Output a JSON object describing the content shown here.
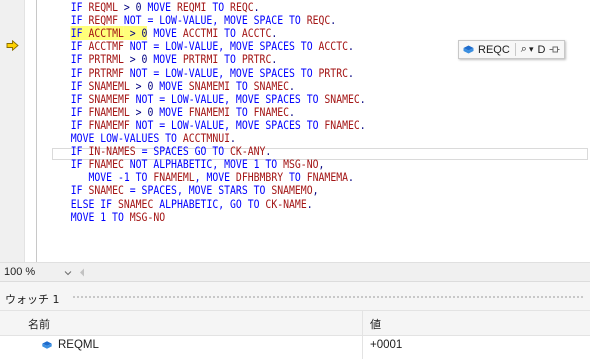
{
  "editor": {
    "lines": [
      [
        {
          "t": "            "
        },
        {
          "t": "IF ",
          "c": "kw"
        },
        {
          "t": "REQML",
          "c": "id"
        },
        {
          "t": " > 0 ",
          "c": "pl"
        },
        {
          "t": "MOVE ",
          "c": "kw"
        },
        {
          "t": "REQMI",
          "c": "id"
        },
        {
          "t": " TO ",
          "c": "kw"
        },
        {
          "t": "REQC",
          "c": "id"
        },
        {
          "t": ".",
          "c": "pl"
        }
      ],
      [
        {
          "t": "            "
        },
        {
          "t": "IF ",
          "c": "kw"
        },
        {
          "t": "REQMF",
          "c": "id"
        },
        {
          "t": " NOT = LOW-VALUE, MOVE SPACE TO ",
          "c": "kw"
        },
        {
          "t": "REQC",
          "c": "id"
        },
        {
          "t": ".",
          "c": "pl"
        }
      ],
      [
        {
          "t": "            "
        },
        {
          "t": "IF ",
          "c": "kw",
          "h": 1
        },
        {
          "t": "ACCTML",
          "c": "id",
          "h": 1
        },
        {
          "t": " > 0",
          "c": "pl",
          "h": 1
        },
        {
          "t": " MOVE ",
          "c": "kw"
        },
        {
          "t": "ACCTMI",
          "c": "id"
        },
        {
          "t": " TO ",
          "c": "kw"
        },
        {
          "t": "ACCTC",
          "c": "id"
        },
        {
          "t": ".",
          "c": "pl"
        }
      ],
      [
        {
          "t": "            "
        },
        {
          "t": "IF ",
          "c": "kw"
        },
        {
          "t": "ACCTMF",
          "c": "id"
        },
        {
          "t": " NOT = LOW-VALUE, MOVE SPACES TO ",
          "c": "kw"
        },
        {
          "t": "ACCTC",
          "c": "id"
        },
        {
          "t": ".",
          "c": "pl"
        }
      ],
      [
        {
          "t": "            "
        },
        {
          "t": "IF ",
          "c": "kw"
        },
        {
          "t": "PRTRML",
          "c": "id"
        },
        {
          "t": " > 0 ",
          "c": "pl"
        },
        {
          "t": "MOVE ",
          "c": "kw"
        },
        {
          "t": "PRTRMI",
          "c": "id"
        },
        {
          "t": " TO ",
          "c": "kw"
        },
        {
          "t": "PRTRC",
          "c": "id"
        },
        {
          "t": ".",
          "c": "pl"
        }
      ],
      [
        {
          "t": "            "
        },
        {
          "t": "IF ",
          "c": "kw"
        },
        {
          "t": "PRTRMF",
          "c": "id"
        },
        {
          "t": " NOT = LOW-VALUE, MOVE SPACES TO ",
          "c": "kw"
        },
        {
          "t": "PRTRC",
          "c": "id"
        },
        {
          "t": ".",
          "c": "pl"
        }
      ],
      [
        {
          "t": "            "
        },
        {
          "t": "IF ",
          "c": "kw"
        },
        {
          "t": "SNAMEML",
          "c": "id"
        },
        {
          "t": " > 0 ",
          "c": "pl"
        },
        {
          "t": "MOVE ",
          "c": "kw"
        },
        {
          "t": "SNAMEMI",
          "c": "id"
        },
        {
          "t": " TO ",
          "c": "kw"
        },
        {
          "t": "SNAMEC",
          "c": "id"
        },
        {
          "t": ".",
          "c": "pl"
        }
      ],
      [
        {
          "t": "            "
        },
        {
          "t": "IF ",
          "c": "kw"
        },
        {
          "t": "SNAMEMF",
          "c": "id"
        },
        {
          "t": " NOT = LOW-VALUE, MOVE SPACES TO ",
          "c": "kw"
        },
        {
          "t": "SNAMEC",
          "c": "id"
        },
        {
          "t": ".",
          "c": "pl"
        }
      ],
      [
        {
          "t": "            "
        },
        {
          "t": "IF ",
          "c": "kw"
        },
        {
          "t": "FNAMEML",
          "c": "id"
        },
        {
          "t": " > 0 ",
          "c": "pl"
        },
        {
          "t": "MOVE ",
          "c": "kw"
        },
        {
          "t": "FNAMEMI",
          "c": "id"
        },
        {
          "t": " TO ",
          "c": "kw"
        },
        {
          "t": "FNAMEC",
          "c": "id"
        },
        {
          "t": ".",
          "c": "pl"
        }
      ],
      [
        {
          "t": "            "
        },
        {
          "t": "IF ",
          "c": "kw"
        },
        {
          "t": "FNAMEMF",
          "c": "id"
        },
        {
          "t": " NOT = LOW-VALUE, MOVE SPACES TO ",
          "c": "kw"
        },
        {
          "t": "FNAMEC",
          "c": "id"
        },
        {
          "t": ".",
          "c": "pl"
        }
      ],
      [
        {
          "t": "            "
        },
        {
          "t": "MOVE LOW-VALUES TO ",
          "c": "kw"
        },
        {
          "t": "ACCTMNUI",
          "c": "id"
        },
        {
          "t": ".",
          "c": "pl"
        }
      ],
      [
        {
          "t": "            "
        },
        {
          "t": "IF ",
          "c": "kw"
        },
        {
          "t": "IN-NAMES",
          "c": "id"
        },
        {
          "t": " = SPACES GO TO ",
          "c": "kw"
        },
        {
          "t": "CK-ANY",
          "c": "id"
        },
        {
          "t": ".",
          "c": "pl"
        }
      ],
      [
        {
          "t": "            "
        },
        {
          "t": "IF ",
          "c": "kw"
        },
        {
          "t": "FNAMEC",
          "c": "id"
        },
        {
          "t": " NOT ALPHABETIC, MOVE 1 TO ",
          "c": "kw"
        },
        {
          "t": "MSG-NO",
          "c": "id"
        },
        {
          "t": ",",
          "c": "pl"
        }
      ],
      [
        {
          "t": "               "
        },
        {
          "t": "MOVE -1 TO ",
          "c": "kw"
        },
        {
          "t": "FNAMEML",
          "c": "id"
        },
        {
          "t": ", MOVE ",
          "c": "kw"
        },
        {
          "t": "DFHBMBRY",
          "c": "id"
        },
        {
          "t": " TO ",
          "c": "kw"
        },
        {
          "t": "FNAMEMA",
          "c": "id"
        },
        {
          "t": ".",
          "c": "pl"
        }
      ],
      [
        {
          "t": "            "
        },
        {
          "t": "IF ",
          "c": "kw"
        },
        {
          "t": "SNAMEC",
          "c": "id"
        },
        {
          "t": " = SPACES, MOVE STARS TO ",
          "c": "kw"
        },
        {
          "t": "SNAMEMO",
          "c": "id"
        },
        {
          "t": ",",
          "c": "pl"
        }
      ],
      [
        {
          "t": "            "
        },
        {
          "t": "ELSE IF ",
          "c": "kw"
        },
        {
          "t": "SNAMEC",
          "c": "id"
        },
        {
          "t": " ALPHABETIC, GO TO ",
          "c": "kw"
        },
        {
          "t": "CK-NAME",
          "c": "id"
        },
        {
          "t": ".",
          "c": "pl"
        }
      ],
      [
        {
          "t": "            "
        },
        {
          "t": "MOVE 1 TO ",
          "c": "kw"
        },
        {
          "t": "MSG-NO",
          "c": "id"
        }
      ]
    ],
    "colors": {
      "kw": "#0000ff",
      "id": "#a31515",
      "pl": "#000080",
      "highlight": "#ffff7a"
    },
    "datatip": {
      "variable": "REQC",
      "search_glyph": "⌕",
      "dropdown_glyph": "▾",
      "value_preview": "D"
    }
  },
  "zoombar": {
    "zoom_label": "100 %"
  },
  "watch": {
    "title": "ウォッチ 1",
    "columns": {
      "name": "名前",
      "value": "値"
    },
    "rows": [
      {
        "name": "REQML",
        "value": "+0001"
      }
    ]
  }
}
